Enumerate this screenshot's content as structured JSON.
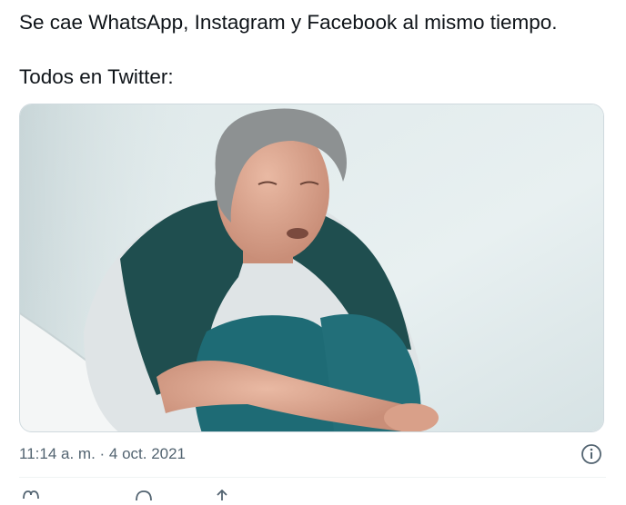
{
  "tweet": {
    "text_line1": "Se cae WhatsApp, Instagram y Facebook al mismo tiempo.",
    "text_line2": "Todos en Twitter:",
    "timestamp": "11:14 a. m. · 4 oct. 2021",
    "image_alt": "Anciano sentado en el suelo abrazando sus rodillas contra una pared blanca"
  },
  "icons": {
    "info": "info-icon",
    "like": "heart-icon",
    "reply": "reply-icon",
    "share": "share-icon"
  },
  "colors": {
    "text": "#0f1419",
    "secondary": "#536471",
    "border": "#cfd9de"
  }
}
